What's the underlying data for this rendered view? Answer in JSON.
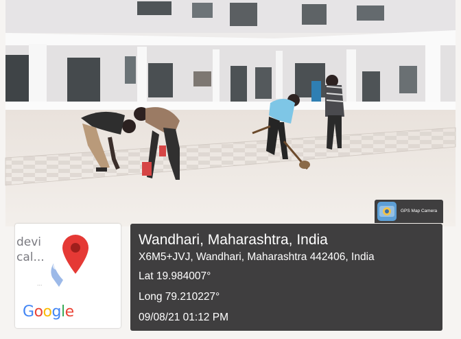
{
  "scene": {
    "description_icon": "photo-scene"
  },
  "badge": {
    "label": "GPS Map Camera",
    "icon": "gps-map-camera-icon"
  },
  "map": {
    "text_line1": "devi",
    "text_line2": "cal...",
    "dots": "...",
    "pin_icon": "location-pin-icon",
    "pin_color": "#e53935",
    "logo": {
      "letters": [
        "G",
        "o",
        "o",
        "g",
        "l",
        "e"
      ],
      "colors": [
        "#4285f4",
        "#ea4335",
        "#fbbc05",
        "#4285f4",
        "#34a853",
        "#ea4335"
      ]
    }
  },
  "info": {
    "place": "Wandhari, Maharashtra, India",
    "address": "X6M5+JVJ, Wandhari, Maharashtra 442406, India",
    "lat": "Lat 19.984007°",
    "long": "Long 79.210227°",
    "datetime": "09/08/21 01:12 PM"
  }
}
